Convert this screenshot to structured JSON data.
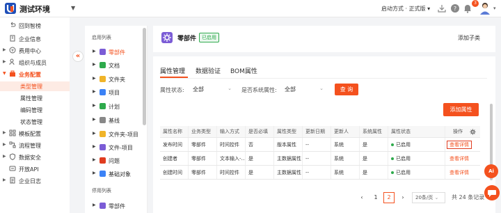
{
  "app": {
    "title": "测试环境",
    "launch_mode": "启动方式 · 正式版",
    "notification_count": "3",
    "accent": "#f4511e"
  },
  "sidebar": {
    "items": [
      {
        "label": "回到智榜",
        "expandable": false
      },
      {
        "label": "企业信息",
        "expandable": false
      },
      {
        "label": "费用中心",
        "expandable": true
      },
      {
        "label": "组织与成员",
        "expandable": true
      },
      {
        "label": "业务配置",
        "expandable": true,
        "active": true
      }
    ],
    "sub_items": [
      {
        "label": "类型管理",
        "active": true
      },
      {
        "label": "属性管理"
      },
      {
        "label": "编码管理"
      },
      {
        "label": "状态管理"
      }
    ],
    "items_after": [
      {
        "label": "模板配置"
      },
      {
        "label": "流程管理"
      },
      {
        "label": "数据安全"
      },
      {
        "label": "开放API"
      },
      {
        "label": "企业日志"
      }
    ]
  },
  "tree": {
    "enabled_header": "启用列表",
    "enabled": [
      {
        "label": "零部件",
        "color": "#7b5cd6",
        "active": true
      },
      {
        "label": "文档",
        "color": "#2eaa4c"
      },
      {
        "label": "文件夹",
        "color": "#f0b429"
      },
      {
        "label": "项目",
        "color": "#3b82f6"
      },
      {
        "label": "计划",
        "color": "#2eaa4c"
      },
      {
        "label": "基线",
        "color": "#888888"
      },
      {
        "label": "文件夹-项目",
        "color": "#f0b429"
      },
      {
        "label": "文件-项目",
        "color": "#7b5cd6"
      },
      {
        "label": "问题",
        "color": "#e03c1f"
      },
      {
        "label": "基础对象",
        "color": "#3b82f6"
      }
    ],
    "disabled_header": "停用列表",
    "disabled": [
      {
        "label": "零部件",
        "color": "#7b5cd6"
      }
    ]
  },
  "header": {
    "title": "零部件",
    "status": "已启用",
    "add_child": "添加子类"
  },
  "tabs": [
    {
      "label": "属性管理",
      "active": true
    },
    {
      "label": "数据验证"
    },
    {
      "label": "BOM属性"
    }
  ],
  "filters": {
    "status_label": "属性状态:",
    "status_value": "全部",
    "required_label": "是否系统属性:",
    "required_value": "全部",
    "query_button": "查 询"
  },
  "add_attr_button": "添加属性",
  "table": {
    "columns": [
      "属性名称",
      "业务类型",
      "输入方式",
      "是否必填",
      "属性类型",
      "更新日期",
      "更新人",
      "系统属性",
      "属性状态",
      "操作"
    ],
    "rows": [
      [
        "发布时间",
        "零部件",
        "时间控件",
        "否",
        "版本属性",
        "--",
        "系统",
        "是",
        "已启用",
        "查看详情"
      ],
      [
        "创建者",
        "零部件",
        "文本输入-...",
        "是",
        "主数据属性",
        "--",
        "系统",
        "是",
        "已启用",
        "查看详情"
      ],
      [
        "创建时间",
        "零部件",
        "时间控件",
        "是",
        "主数据属性",
        "--",
        "系统",
        "是",
        "已启用",
        "查看详情"
      ]
    ]
  },
  "pagination": {
    "prev": "‹",
    "pages": [
      "1",
      "2"
    ],
    "current": "2",
    "next": "›",
    "page_size": "20条/页",
    "total": "共 24 条记录"
  },
  "float": {
    "ai_label": "Ai"
  }
}
